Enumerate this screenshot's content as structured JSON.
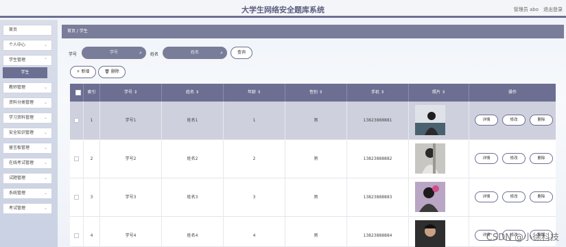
{
  "header": {
    "title": "大学生网络安全题库系统",
    "user": "管理员 abo",
    "logout": "退出登录"
  },
  "sidebar": {
    "items": [
      {
        "label": "首页",
        "has_children": false
      },
      {
        "label": "个人中心",
        "has_children": true
      },
      {
        "label": "学生管理",
        "has_children": true
      },
      {
        "label": "教师管理",
        "has_children": true
      },
      {
        "label": "资料分类管理",
        "has_children": true
      },
      {
        "label": "学习资料管理",
        "has_children": true
      },
      {
        "label": "安全知识管理",
        "has_children": true
      },
      {
        "label": "留言板管理",
        "has_children": true
      },
      {
        "label": "在线考试管理",
        "has_children": true
      },
      {
        "label": "试题管理",
        "has_children": true
      },
      {
        "label": "系统管理",
        "has_children": true
      },
      {
        "label": "考试管理",
        "has_children": true
      }
    ],
    "active_sub": "学生"
  },
  "breadcrumb": "首页 / 学生",
  "search": {
    "label_id": "学号",
    "placeholder_id": "学号",
    "label_name": "姓名",
    "placeholder_name": "姓名",
    "search_button": "查询",
    "add_button": "+ 新增",
    "delete_button": "删除"
  },
  "table": {
    "headers": [
      "索引",
      "学号",
      "姓名",
      "年龄",
      "性别",
      "手机",
      "照片",
      "操作"
    ],
    "rows": [
      {
        "index": "1",
        "id": "学号1",
        "name": "姓名1",
        "age": "1",
        "gender": "男",
        "phone": "13823888881"
      },
      {
        "index": "2",
        "id": "学号2",
        "name": "姓名2",
        "age": "2",
        "gender": "男",
        "phone": "13823888882"
      },
      {
        "index": "3",
        "id": "学号3",
        "name": "姓名3",
        "age": "3",
        "gender": "男",
        "phone": "13823888883"
      },
      {
        "index": "4",
        "id": "学号4",
        "name": "姓名4",
        "age": "4",
        "gender": "男",
        "phone": "13823888884"
      }
    ],
    "actions": {
      "detail": "详情",
      "edit": "修改",
      "delete": "删除"
    }
  },
  "watermark": "CSDN @小徐科技",
  "colors": {
    "accent": "#6c6f92",
    "breadcrumb": "#7a7d99"
  }
}
